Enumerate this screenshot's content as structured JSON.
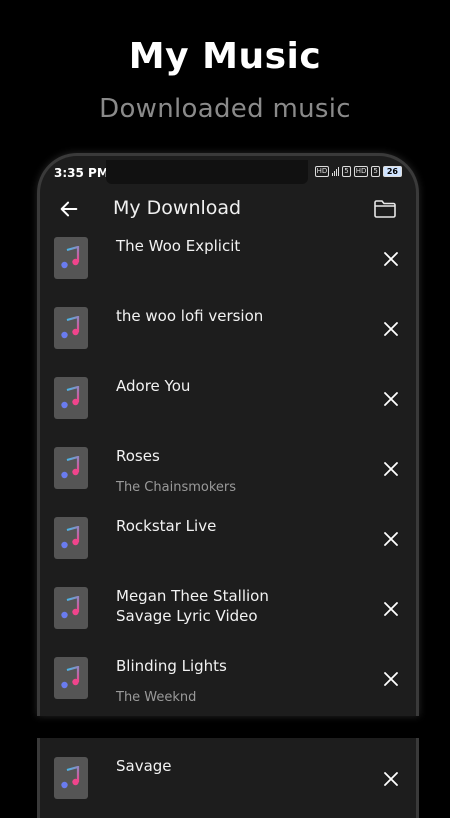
{
  "hero": {
    "title": "My Music",
    "subtitle": "Downloaded music"
  },
  "status_bar": {
    "time": "3:35 PM",
    "icons": [
      "HD",
      "5",
      "HD",
      "5"
    ],
    "battery": "26"
  },
  "app_bar": {
    "title": "My Download",
    "back_icon": "arrow-left-icon",
    "folder_icon": "folder-icon"
  },
  "songs": [
    {
      "title": "The Woo Explicit",
      "artist": ""
    },
    {
      "title": "the woo lofi version",
      "artist": ""
    },
    {
      "title": "Adore You",
      "artist": ""
    },
    {
      "title": "Roses",
      "artist": "The Chainsmokers"
    },
    {
      "title": "Rockstar Live",
      "artist": ""
    },
    {
      "title": "Megan Thee Stallion Savage Lyric Video",
      "artist": ""
    },
    {
      "title": "Blinding Lights",
      "artist": "The Weeknd"
    },
    {
      "title": "Savage",
      "artist": ""
    }
  ],
  "colors": {
    "background": "#000000",
    "panel": "#1d1d1d",
    "subtitle": "#8a8a8a",
    "artist": "#9a9a9a",
    "thumb": "#555555",
    "note_blue": "#34c6f4",
    "note_pink": "#f0448c"
  }
}
